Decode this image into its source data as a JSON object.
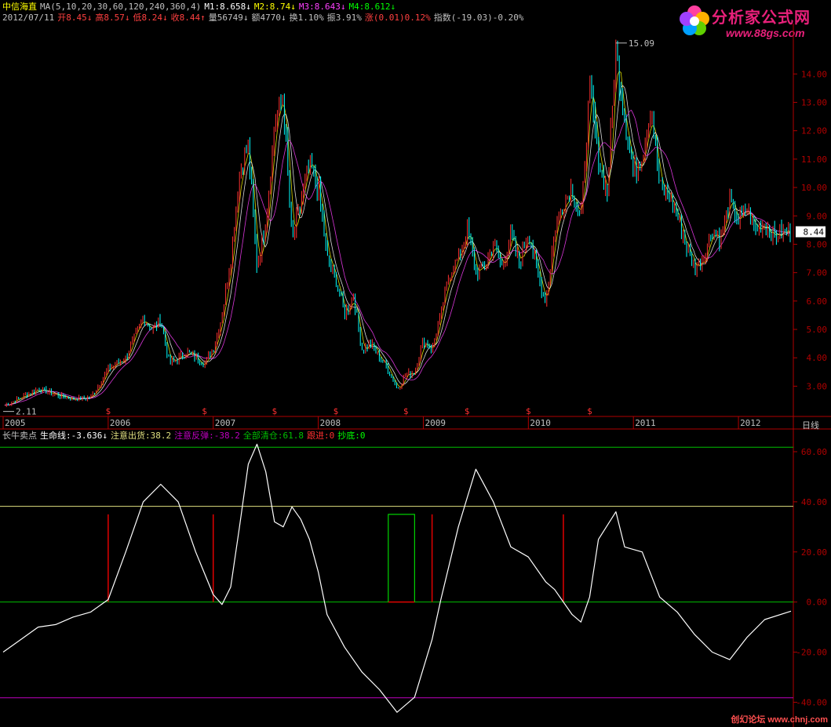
{
  "header": {
    "stock_name": "中信海直",
    "ma_label": "MA(5,10,20,30,60,120,240,360,4)",
    "m1": "M1:8.658↓",
    "m2": "M2:8.74↓",
    "m3": "M3:8.643↓",
    "m4": "M4:8.612↓",
    "date": "2012/07/11",
    "open": "开8.45↓",
    "high": "高8.57↓",
    "low": "低8.24↓",
    "close": "收8.44↑",
    "volume": "量56749↓",
    "amount": "额4770↓",
    "turnover": "换1.10%",
    "amplitude": "振3.91%",
    "change": "涨(0.01)0.12%",
    "index": "指数(-19.03)-0.20%"
  },
  "logo": {
    "title": "分析家公式网",
    "url": "www.88gs.com"
  },
  "footer_mark": "创幻论坛 www.chnj.com",
  "period_label": "日线",
  "colors": {
    "background": "#000000",
    "grid_axis": "#b00000",
    "up": "#ff3030",
    "down": "#00ffff",
    "life_line": "#ffffff",
    "level_yellow": "#e0e080",
    "level_green": "#00c000",
    "level_magenta": "#c000c0",
    "signal_red": "#e00000"
  },
  "chart_data": [
    {
      "type": "candlestick",
      "title": "",
      "yticks": [
        "14.00",
        "13.00",
        "12.00",
        "11.00",
        "10.00",
        "9.00",
        "8.00",
        "7.00",
        "6.00",
        "5.00",
        "4.00",
        "3.00"
      ],
      "ylim": [
        2.1,
        15.5
      ],
      "x_years": [
        "2005",
        "2006",
        "2007",
        "2008",
        "2009",
        "2010",
        "2011",
        "2012"
      ],
      "annotations": [
        {
          "label": "15.09",
          "x": "2010-11",
          "y": 15.09
        },
        {
          "label": "2.11",
          "x": "2005-01",
          "y": 2.11
        }
      ],
      "current_price": "8.44",
      "buy_markers": [
        "$",
        "$",
        "$",
        "$",
        "$",
        "$",
        "$",
        "$"
      ],
      "close_series": [
        {
          "x": "2005-01",
          "y": 2.3
        },
        {
          "x": "2005-03",
          "y": 2.6
        },
        {
          "x": "2005-05",
          "y": 2.9
        },
        {
          "x": "2005-07",
          "y": 2.7
        },
        {
          "x": "2005-09",
          "y": 2.55
        },
        {
          "x": "2005-11",
          "y": 2.6
        },
        {
          "x": "2006-01",
          "y": 3.6
        },
        {
          "x": "2006-03",
          "y": 4.0
        },
        {
          "x": "2006-05",
          "y": 5.4
        },
        {
          "x": "2006-06",
          "y": 5.0
        },
        {
          "x": "2006-07",
          "y": 5.3
        },
        {
          "x": "2006-08",
          "y": 3.8
        },
        {
          "x": "2006-10",
          "y": 4.2
        },
        {
          "x": "2006-12",
          "y": 3.8
        },
        {
          "x": "2007-01",
          "y": 4.3
        },
        {
          "x": "2007-02",
          "y": 5.5
        },
        {
          "x": "2007-03",
          "y": 7.5
        },
        {
          "x": "2007-04",
          "y": 10.5
        },
        {
          "x": "2007-05",
          "y": 11.5
        },
        {
          "x": "2007-06",
          "y": 7.2
        },
        {
          "x": "2007-07",
          "y": 8.8
        },
        {
          "x": "2007-08",
          "y": 12.2
        },
        {
          "x": "2007-09",
          "y": 13.2
        },
        {
          "x": "2007-10",
          "y": 8.0
        },
        {
          "x": "2007-11",
          "y": 9.5
        },
        {
          "x": "2007-12",
          "y": 10.8
        },
        {
          "x": "2008-01",
          "y": 10.0
        },
        {
          "x": "2008-02",
          "y": 7.5
        },
        {
          "x": "2008-03",
          "y": 6.8
        },
        {
          "x": "2008-04",
          "y": 5.5
        },
        {
          "x": "2008-05",
          "y": 6.2
        },
        {
          "x": "2008-06",
          "y": 4.3
        },
        {
          "x": "2008-07",
          "y": 4.5
        },
        {
          "x": "2008-08",
          "y": 4.0
        },
        {
          "x": "2008-09",
          "y": 3.6
        },
        {
          "x": "2008-10",
          "y": 2.9
        },
        {
          "x": "2008-11",
          "y": 3.4
        },
        {
          "x": "2008-12",
          "y": 3.5
        },
        {
          "x": "2009-01",
          "y": 4.6
        },
        {
          "x": "2009-02",
          "y": 4.3
        },
        {
          "x": "2009-03",
          "y": 5.5
        },
        {
          "x": "2009-04",
          "y": 7.0
        },
        {
          "x": "2009-05",
          "y": 7.5
        },
        {
          "x": "2009-06",
          "y": 8.5
        },
        {
          "x": "2009-07",
          "y": 7.0
        },
        {
          "x": "2009-08",
          "y": 7.2
        },
        {
          "x": "2009-09",
          "y": 8.0
        },
        {
          "x": "2009-10",
          "y": 7.2
        },
        {
          "x": "2009-11",
          "y": 8.3
        },
        {
          "x": "2009-12",
          "y": 7.3
        },
        {
          "x": "2010-01",
          "y": 8.5
        },
        {
          "x": "2010-02",
          "y": 7.0
        },
        {
          "x": "2010-03",
          "y": 6.0
        },
        {
          "x": "2010-04",
          "y": 8.5
        },
        {
          "x": "2010-05",
          "y": 9.5
        },
        {
          "x": "2010-06",
          "y": 10.0
        },
        {
          "x": "2010-07",
          "y": 8.8
        },
        {
          "x": "2010-08",
          "y": 13.5
        },
        {
          "x": "2010-09",
          "y": 11.0
        },
        {
          "x": "2010-10",
          "y": 9.8
        },
        {
          "x": "2010-11",
          "y": 14.8
        },
        {
          "x": "2010-12",
          "y": 12.5
        },
        {
          "x": "2011-01",
          "y": 10.5
        },
        {
          "x": "2011-02",
          "y": 11.2
        },
        {
          "x": "2011-03",
          "y": 12.8
        },
        {
          "x": "2011-04",
          "y": 10.0
        },
        {
          "x": "2011-05",
          "y": 9.8
        },
        {
          "x": "2011-06",
          "y": 9.0
        },
        {
          "x": "2011-07",
          "y": 8.0
        },
        {
          "x": "2011-08",
          "y": 7.2
        },
        {
          "x": "2011-09",
          "y": 7.5
        },
        {
          "x": "2011-10",
          "y": 8.5
        },
        {
          "x": "2011-11",
          "y": 8.2
        },
        {
          "x": "2011-12",
          "y": 9.5
        },
        {
          "x": "2012-01",
          "y": 8.8
        },
        {
          "x": "2012-02",
          "y": 9.2
        },
        {
          "x": "2012-03",
          "y": 8.5
        },
        {
          "x": "2012-04",
          "y": 8.8
        },
        {
          "x": "2012-05",
          "y": 8.3
        },
        {
          "x": "2012-07",
          "y": 8.44
        }
      ]
    },
    {
      "type": "line",
      "title": "长牛卖点",
      "legend": [
        {
          "label": "生命线:-3.636↓",
          "color": "#ffffff"
        },
        {
          "label": "注意出货:38.2",
          "color": "#e0e080"
        },
        {
          "label": "注意反弹:-38.2",
          "color": "#c000c0"
        },
        {
          "label": "全部清仓:61.8",
          "color": "#00c000"
        },
        {
          "label": "跟进:0",
          "color": "#ff3030"
        },
        {
          "label": "抄底:0",
          "color": "#00ff00"
        }
      ],
      "yticks": [
        "60.00",
        "40.00",
        "20.00",
        "0.00",
        "-20.00",
        "-40.00"
      ],
      "ylim": [
        -48,
        65
      ],
      "levels": [
        {
          "name": "全部清仓",
          "value": 61.8,
          "color": "#00c000"
        },
        {
          "name": "注意出货",
          "value": 38.2,
          "color": "#e0e080"
        },
        {
          "name": "零轴",
          "value": 0,
          "color": "#00c000"
        },
        {
          "name": "注意反弹",
          "value": -38.2,
          "color": "#c000c0"
        }
      ],
      "signals": [
        {
          "x": "2006-01",
          "value": 35
        },
        {
          "x": "2007-01",
          "value": 35
        },
        {
          "x": "2009-02",
          "value": 35
        },
        {
          "x": "2010-05",
          "value": 35
        }
      ],
      "box": {
        "x_start": "2008-09",
        "x_end": "2008-12",
        "value": 35
      },
      "series": [
        {
          "name": "生命线",
          "points": [
            {
              "x": "2005-01",
              "y": -20
            },
            {
              "x": "2005-03",
              "y": -15
            },
            {
              "x": "2005-05",
              "y": -10
            },
            {
              "x": "2005-07",
              "y": -9
            },
            {
              "x": "2005-09",
              "y": -6
            },
            {
              "x": "2005-11",
              "y": -4
            },
            {
              "x": "2006-01",
              "y": 1
            },
            {
              "x": "2006-03",
              "y": 20
            },
            {
              "x": "2006-05",
              "y": 40
            },
            {
              "x": "2006-07",
              "y": 47
            },
            {
              "x": "2006-09",
              "y": 40
            },
            {
              "x": "2006-11",
              "y": 20
            },
            {
              "x": "2007-01",
              "y": 3
            },
            {
              "x": "2007-02",
              "y": -1
            },
            {
              "x": "2007-03",
              "y": 6
            },
            {
              "x": "2007-04",
              "y": 30
            },
            {
              "x": "2007-05",
              "y": 55
            },
            {
              "x": "2007-06",
              "y": 63
            },
            {
              "x": "2007-07",
              "y": 52
            },
            {
              "x": "2007-08",
              "y": 32
            },
            {
              "x": "2007-09",
              "y": 30
            },
            {
              "x": "2007-10",
              "y": 38
            },
            {
              "x": "2007-11",
              "y": 33
            },
            {
              "x": "2007-12",
              "y": 25
            },
            {
              "x": "2008-01",
              "y": 12
            },
            {
              "x": "2008-02",
              "y": -5
            },
            {
              "x": "2008-04",
              "y": -18
            },
            {
              "x": "2008-06",
              "y": -28
            },
            {
              "x": "2008-08",
              "y": -35
            },
            {
              "x": "2008-10",
              "y": -44
            },
            {
              "x": "2008-12",
              "y": -38
            },
            {
              "x": "2009-02",
              "y": -15
            },
            {
              "x": "2009-03",
              "y": 1
            },
            {
              "x": "2009-05",
              "y": 30
            },
            {
              "x": "2009-07",
              "y": 53
            },
            {
              "x": "2009-09",
              "y": 40
            },
            {
              "x": "2009-11",
              "y": 22
            },
            {
              "x": "2010-01",
              "y": 18
            },
            {
              "x": "2010-03",
              "y": 8
            },
            {
              "x": "2010-04",
              "y": 5
            },
            {
              "x": "2010-06",
              "y": -5
            },
            {
              "x": "2010-07",
              "y": -8
            },
            {
              "x": "2010-08",
              "y": 2
            },
            {
              "x": "2010-09",
              "y": 25
            },
            {
              "x": "2010-11",
              "y": 36
            },
            {
              "x": "2010-12",
              "y": 22
            },
            {
              "x": "2011-02",
              "y": 20
            },
            {
              "x": "2011-04",
              "y": 2
            },
            {
              "x": "2011-06",
              "y": -4
            },
            {
              "x": "2011-08",
              "y": -13
            },
            {
              "x": "2011-10",
              "y": -20
            },
            {
              "x": "2011-12",
              "y": -23
            },
            {
              "x": "2012-02",
              "y": -14
            },
            {
              "x": "2012-04",
              "y": -7
            },
            {
              "x": "2012-07",
              "y": -3.636
            }
          ]
        }
      ]
    }
  ]
}
